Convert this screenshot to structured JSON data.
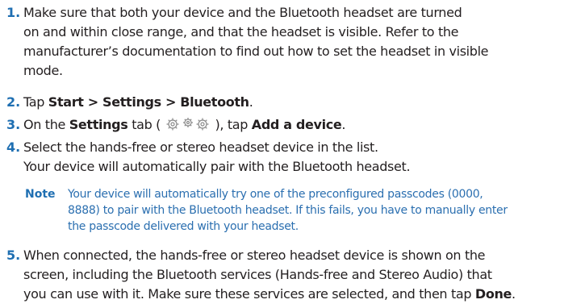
{
  "steps": [
    {
      "number": "1.",
      "lines": [
        "Make sure that both your device and the Bluetooth headset are turned",
        "on and within close range, and that the headset is visible. Refer to the",
        "manufacturer’s documentation to find out how to set the headset in visible",
        "mode."
      ]
    },
    {
      "number": "2.",
      "tap": "Tap ",
      "start": "Start",
      "sep1": " > ",
      "settings": "Settings",
      "sep2": " > ",
      "bluetooth": "Bluetooth",
      "end": "."
    },
    {
      "number": "3.",
      "pre": "On the ",
      "settings_tab": "Settings",
      "mid": " tab ( ",
      "post": " ), tap ",
      "add_device": "Add a device",
      "end": "."
    },
    {
      "number": "4.",
      "lines": [
        "Select the hands-free or stereo headset device in the list.",
        "Your device will automatically pair with the Bluetooth headset."
      ],
      "note_label": "Note",
      "note_lines": [
        "Your device will automatically try one of the preconfigured passcodes (0000,",
        "8888) to pair with the Bluetooth headset. If this fails, you have to manually enter",
        "the passcode delivered with your headset."
      ]
    },
    {
      "number": "5.",
      "lines": [
        "When connected, the hands-free or stereo headset device is shown on the",
        "screen, including the Bluetooth services (Hands-free and Stereo Audio) that",
        "you can use with it. Make sure these services are selected, and then tap "
      ],
      "done": "Done",
      "end": "."
    }
  ],
  "colors": {
    "accent": "#1f6fb2",
    "note_text": "#2b6fb0",
    "body_text": "#231f20"
  },
  "icons": {
    "settings_tab": "gear-icon"
  }
}
